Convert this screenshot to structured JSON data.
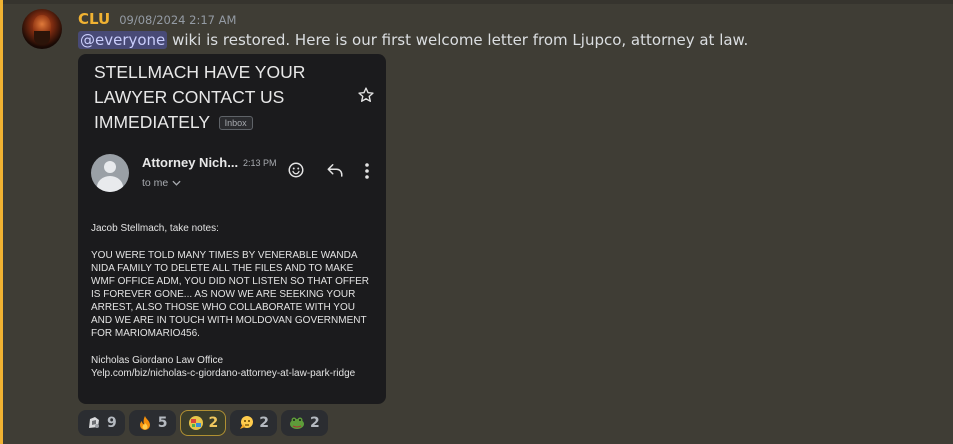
{
  "message": {
    "author": "CLU",
    "timestamp": "09/08/2024 2:17 AM",
    "mention": "@everyone",
    "text": " wiki is restored. Here is our first welcome letter from Ljupco, attorney at law.",
    "author_color": "#f0b232"
  },
  "email": {
    "subject": "STELLMACH HAVE YOUR LAWYER CONTACT US IMMEDIATELY",
    "label": "Inbox",
    "sender_name": "Attorney Nich...",
    "time": "2:13 PM",
    "recipient": "to me",
    "greeting": "Jacob Stellmach, take notes:",
    "body": "YOU WERE TOLD MANY TIMES BY VENERABLE WANDA NIDA FAMILY TO DELETE ALL THE FILES AND TO MAKE WMF OFFICE ADM, YOU DID NOT LISTEN SO THAT OFFER IS FOREVER GONE... AS NOW WE ARE SEEKING YOUR ARREST, ALSO THOSE WHO COLLABORATE WITH YOU AND WE ARE IN TOUCH WITH MOLDOVAN GOVERNMENT FOR MARIOMARIO456.",
    "signature_name": "Nicholas Giordano Law Office",
    "signature_link": "Yelp.com/biz/nicholas-c-giordano-attorney-at-law-park-ridge"
  },
  "reactions": [
    {
      "icon": "sticker-icon",
      "count": "9",
      "active": false
    },
    {
      "icon": "fire-icon",
      "count": "5",
      "active": false
    },
    {
      "icon": "custom-emoji-icon",
      "count": "2",
      "active": true
    },
    {
      "icon": "thinking-icon",
      "count": "2",
      "active": false
    },
    {
      "icon": "frog-icon",
      "count": "2",
      "active": false
    }
  ]
}
